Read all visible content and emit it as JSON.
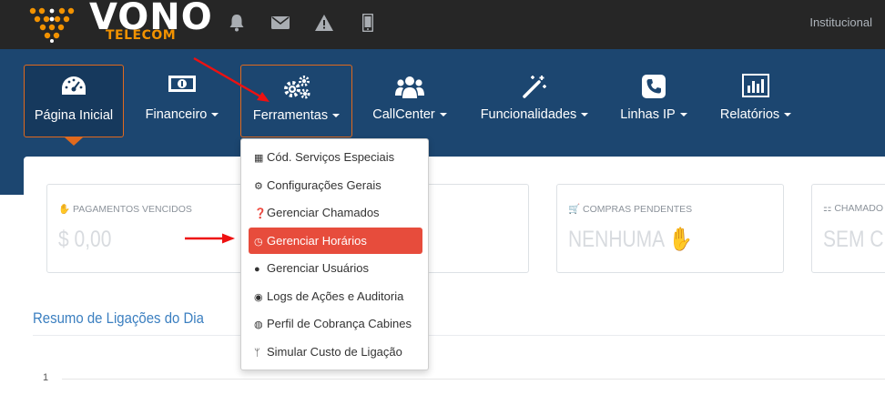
{
  "header": {
    "logo_word": "VONO",
    "logo_sub": "TELECOM",
    "icons": [
      "bell-icon",
      "envelope-icon",
      "warning-icon",
      "mobile-icon"
    ],
    "right_link": "Institucional"
  },
  "nav": {
    "items": [
      {
        "label": "Página Inicial",
        "icon": "dashboard-icon"
      },
      {
        "label": "Financeiro",
        "icon": "money-icon"
      },
      {
        "label": "Ferramentas",
        "icon": "cogs-icon"
      },
      {
        "label": "CallCenter",
        "icon": "users-icon"
      },
      {
        "label": "Funcionalidades",
        "icon": "magic-wand-icon"
      },
      {
        "label": "Linhas IP",
        "icon": "phone-icon"
      },
      {
        "label": "Relatórios",
        "icon": "bar-chart-icon"
      }
    ]
  },
  "dropdown": {
    "items": [
      {
        "label": "Cód. Serviços Especiais",
        "icon": "qrcode-icon"
      },
      {
        "label": "Configurações Gerais",
        "icon": "gear-icon"
      },
      {
        "label": "Gerenciar Chamados",
        "icon": "question-icon"
      },
      {
        "label": "Gerenciar Horários",
        "icon": "clock-icon"
      },
      {
        "label": "Gerenciar Usuários",
        "icon": "user-icon"
      },
      {
        "label": "Logs de Ações e Auditoria",
        "icon": "eye-icon"
      },
      {
        "label": "Perfil de Cobrança Cabines",
        "icon": "globe-icon"
      },
      {
        "label": "Simular Custo de Ligação",
        "icon": "code-fork-icon"
      }
    ],
    "highlighted": "Gerenciar Horários"
  },
  "cards": [
    {
      "title": "PAGAMENTOS VENCIDOS",
      "value": "$ 0,00",
      "icon": "thumbs-down-icon"
    },
    {
      "title": "COMPRAS PENDENTES",
      "value": "NENHUMA",
      "icon": "cart-icon"
    },
    {
      "title": "CHAMADO",
      "value": "SEM CH",
      "icon": "sitemap-icon"
    }
  ],
  "section": {
    "title": "Resumo de Ligações do Dia",
    "tick": "1"
  },
  "colors": {
    "topbar": "#262626",
    "navbar": "#1c4670",
    "accent": "#e0691d",
    "highlight": "#e74c3c",
    "logo_orange": "#f29200",
    "section_title": "#3b7fc0"
  }
}
